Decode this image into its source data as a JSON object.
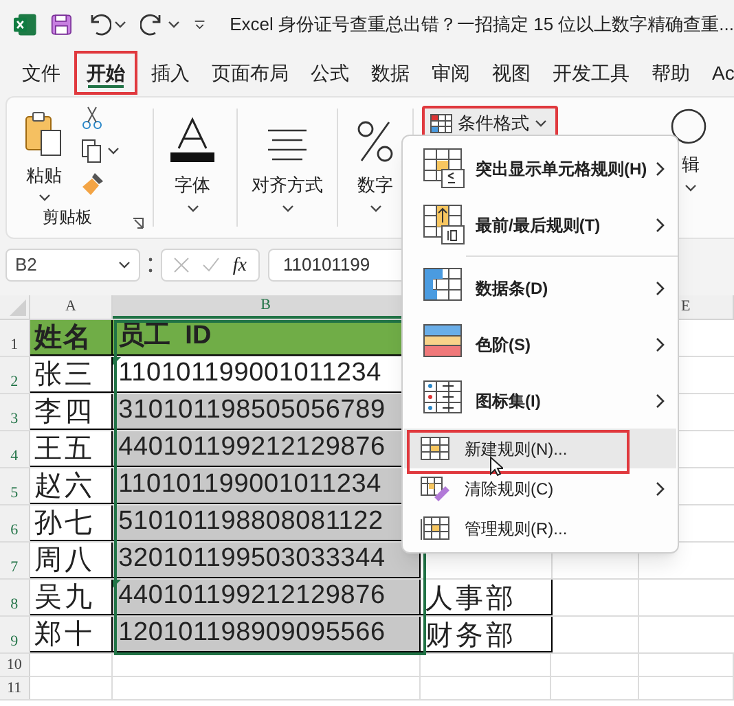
{
  "title_bar": {
    "title": "Excel 身份证号查重总出错？一招搞定 15 位以上数字精确查重..."
  },
  "tabs": [
    {
      "label": "文件",
      "selected": false
    },
    {
      "label": "开始",
      "selected": true
    },
    {
      "label": "插入",
      "selected": false
    },
    {
      "label": "页面布局",
      "selected": false
    },
    {
      "label": "公式",
      "selected": false
    },
    {
      "label": "数据",
      "selected": false
    },
    {
      "label": "审阅",
      "selected": false
    },
    {
      "label": "视图",
      "selected": false
    },
    {
      "label": "开发工具",
      "selected": false
    },
    {
      "label": "帮助",
      "selected": false
    },
    {
      "label": "Ac",
      "selected": false
    }
  ],
  "ribbon": {
    "paste": "粘贴",
    "clipboard_group": "剪贴板",
    "groups": [
      {
        "kind": "font",
        "label": "字体"
      },
      {
        "kind": "align",
        "label": "对齐方式"
      },
      {
        "kind": "number",
        "label": "数字"
      }
    ],
    "conditional_format": "条件格式",
    "editing": "辑"
  },
  "formula_bar": {
    "name_box": "B2",
    "fx": "fx",
    "value": "110101199"
  },
  "sheet": {
    "headers": [
      "A",
      "B",
      "E"
    ],
    "rows": [
      {
        "number": "1",
        "kind": "header",
        "name": "姓名",
        "id": "员工  ID"
      },
      {
        "number": "2",
        "kind": "data",
        "name": "张三",
        "id": "110101199001011234",
        "active": true,
        "flag": true
      },
      {
        "number": "3",
        "kind": "data",
        "name": "李四",
        "id": "310101198505056789",
        "active": false,
        "flag": false
      },
      {
        "number": "4",
        "kind": "data",
        "name": "王五",
        "id": "440101199212129876",
        "active": false,
        "flag": false
      },
      {
        "number": "5",
        "kind": "data",
        "name": "赵六",
        "id": "110101199001011234",
        "active": false,
        "flag": false
      },
      {
        "number": "6",
        "kind": "data",
        "name": "孙七",
        "id": "510101198808081122",
        "active": false,
        "flag": false
      },
      {
        "number": "7",
        "kind": "data",
        "name": "周八",
        "id": "320101199503033344",
        "active": false,
        "flag": false
      },
      {
        "number": "8",
        "kind": "data",
        "name": "吴九",
        "id": "440101199212129876",
        "dept": "人事部",
        "active": false,
        "flag": true
      },
      {
        "number": "9",
        "kind": "data",
        "name": "郑十",
        "id": "120101198909095566",
        "dept": "财务部",
        "active": false,
        "flag": false
      },
      {
        "number": "10",
        "kind": "empty"
      },
      {
        "number": "11",
        "kind": "empty"
      }
    ]
  },
  "menu": {
    "items": [
      {
        "kind": "highlight",
        "label": "突出显示单元格规则(H)",
        "submenu": true,
        "selected": false
      },
      {
        "kind": "topbottom",
        "label": "最前/最后规则(T)",
        "submenu": true,
        "selected": false
      },
      {
        "kind": "databar",
        "label": "数据条(D)",
        "submenu": true,
        "selected": false
      },
      {
        "kind": "colorscale",
        "label": "色阶(S)",
        "submenu": true,
        "selected": false
      },
      {
        "kind": "iconset",
        "label": "图标集(I)",
        "submenu": true,
        "selected": false
      },
      {
        "kind": "new",
        "label": "新建规则(N)...",
        "submenu": false,
        "selected": true
      },
      {
        "kind": "clear",
        "label": "清除规则(C)",
        "submenu": true,
        "selected": false
      },
      {
        "kind": "manage",
        "label": "管理规则(R)...",
        "submenu": false,
        "selected": false
      }
    ]
  }
}
